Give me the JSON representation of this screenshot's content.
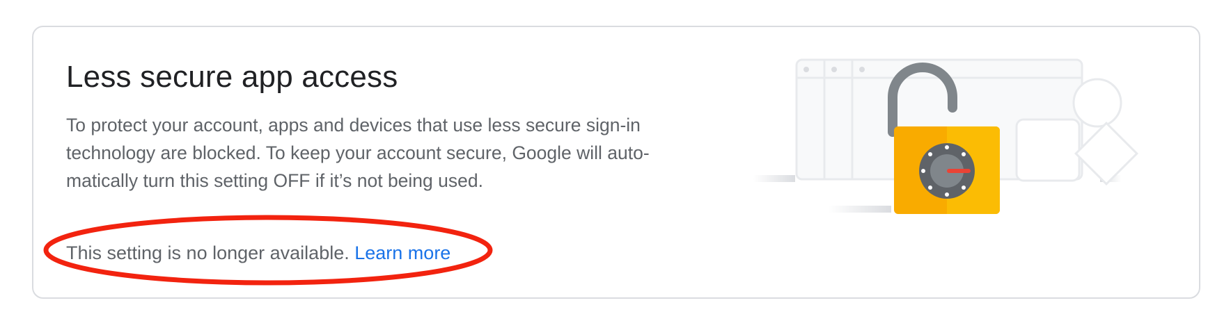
{
  "card": {
    "title": "Less secure app access",
    "description": "To protect your account, apps and devices that use less secure sign-in technology are blocked. To keep your account secure, Google will auto-matically turn this setting OFF if it’s not being used.",
    "status_text": "This setting is no longer available.",
    "learn_more_label": "Learn more"
  },
  "illustration": {
    "icon": "padlock-open-icon",
    "padlock_color": "#F9AB00",
    "dial_color": "#5F6368",
    "indicator_color": "#EA4335"
  },
  "annotation": {
    "shape": "ellipse",
    "color": "#F2230F"
  },
  "colors": {
    "link": "#1A73E8",
    "title": "#202124",
    "body_text": "#5F6368",
    "border": "#DADCE0"
  }
}
